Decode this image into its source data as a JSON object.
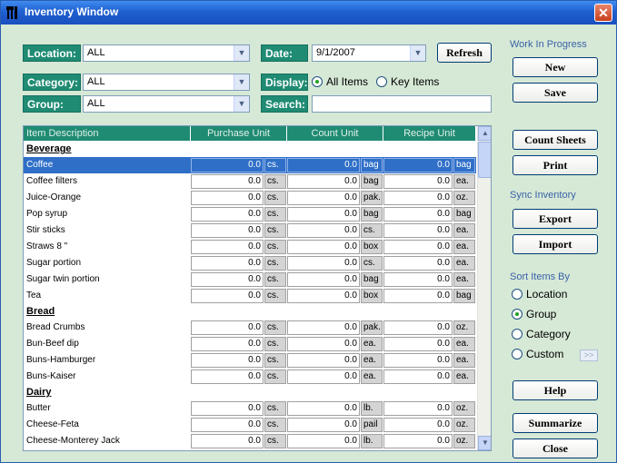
{
  "window": {
    "title": "Inventory Window",
    "close": "✕"
  },
  "filters": {
    "location_label": "Location:",
    "location_value": "ALL",
    "category_label": "Category:",
    "category_value": "ALL",
    "group_label": "Group:",
    "group_value": "ALL",
    "date_label": "Date:",
    "date_value": "9/1/2007",
    "display_label": "Display:",
    "display_opt_all": "All Items",
    "display_opt_key": "Key Items",
    "search_label": "Search:",
    "search_value": "",
    "refresh": "Refresh"
  },
  "side": {
    "wip_label": "Work In Progress",
    "new": "New",
    "save": "Save",
    "count_sheets": "Count Sheets",
    "print": "Print",
    "sync_label": "Sync Inventory",
    "export": "Export",
    "import": "Import",
    "sort_label": "Sort Items By",
    "sort_location": "Location",
    "sort_group": "Group",
    "sort_category": "Category",
    "sort_custom": "Custom",
    "custom_more": ">>",
    "help": "Help",
    "summarize": "Summarize",
    "close": "Close"
  },
  "grid": {
    "headers": [
      "Item Description",
      "Purchase Unit",
      "Count Unit",
      "Recipe Unit"
    ],
    "groups": [
      {
        "name": "Beverage",
        "items": [
          {
            "desc": "Coffee",
            "pq": "0.0",
            "pu": "cs.",
            "cq": "0.0",
            "cu": "bag",
            "rq": "0.0",
            "ru": "bag"
          },
          {
            "desc": "Coffee filters",
            "pq": "0.0",
            "pu": "cs.",
            "cq": "0.0",
            "cu": "bag",
            "rq": "0.0",
            "ru": "ea."
          },
          {
            "desc": "Juice-Orange",
            "pq": "0.0",
            "pu": "cs.",
            "cq": "0.0",
            "cu": "pak.",
            "rq": "0.0",
            "ru": "oz."
          },
          {
            "desc": "Pop syrup",
            "pq": "0.0",
            "pu": "cs.",
            "cq": "0.0",
            "cu": "bag",
            "rq": "0.0",
            "ru": "bag"
          },
          {
            "desc": "Stir sticks",
            "pq": "0.0",
            "pu": "cs.",
            "cq": "0.0",
            "cu": "cs.",
            "rq": "0.0",
            "ru": "ea."
          },
          {
            "desc": "Straws 8 \"",
            "pq": "0.0",
            "pu": "cs.",
            "cq": "0.0",
            "cu": "box",
            "rq": "0.0",
            "ru": "ea."
          },
          {
            "desc": "Sugar portion",
            "pq": "0.0",
            "pu": "cs.",
            "cq": "0.0",
            "cu": "cs.",
            "rq": "0.0",
            "ru": "ea."
          },
          {
            "desc": "Sugar twin portion",
            "pq": "0.0",
            "pu": "cs.",
            "cq": "0.0",
            "cu": "bag",
            "rq": "0.0",
            "ru": "ea."
          },
          {
            "desc": "Tea",
            "pq": "0.0",
            "pu": "cs.",
            "cq": "0.0",
            "cu": "box",
            "rq": "0.0",
            "ru": "bag"
          }
        ]
      },
      {
        "name": "Bread",
        "items": [
          {
            "desc": "Bread Crumbs",
            "pq": "0.0",
            "pu": "cs.",
            "cq": "0.0",
            "cu": "pak.",
            "rq": "0.0",
            "ru": "oz."
          },
          {
            "desc": "Bun-Beef dip",
            "pq": "0.0",
            "pu": "cs.",
            "cq": "0.0",
            "cu": "ea.",
            "rq": "0.0",
            "ru": "ea."
          },
          {
            "desc": "Buns-Hamburger",
            "pq": "0.0",
            "pu": "cs.",
            "cq": "0.0",
            "cu": "ea.",
            "rq": "0.0",
            "ru": "ea."
          },
          {
            "desc": "Buns-Kaiser",
            "pq": "0.0",
            "pu": "cs.",
            "cq": "0.0",
            "cu": "ea.",
            "rq": "0.0",
            "ru": "ea."
          }
        ]
      },
      {
        "name": "Dairy",
        "items": [
          {
            "desc": "Butter",
            "pq": "0.0",
            "pu": "cs.",
            "cq": "0.0",
            "cu": "lb.",
            "rq": "0.0",
            "ru": "oz."
          },
          {
            "desc": "Cheese-Feta",
            "pq": "0.0",
            "pu": "cs.",
            "cq": "0.0",
            "cu": "pail",
            "rq": "0.0",
            "ru": "oz."
          },
          {
            "desc": "Cheese-Monterey Jack",
            "pq": "0.0",
            "pu": "cs.",
            "cq": "0.0",
            "cu": "lb.",
            "rq": "0.0",
            "ru": "oz."
          }
        ]
      }
    ]
  }
}
